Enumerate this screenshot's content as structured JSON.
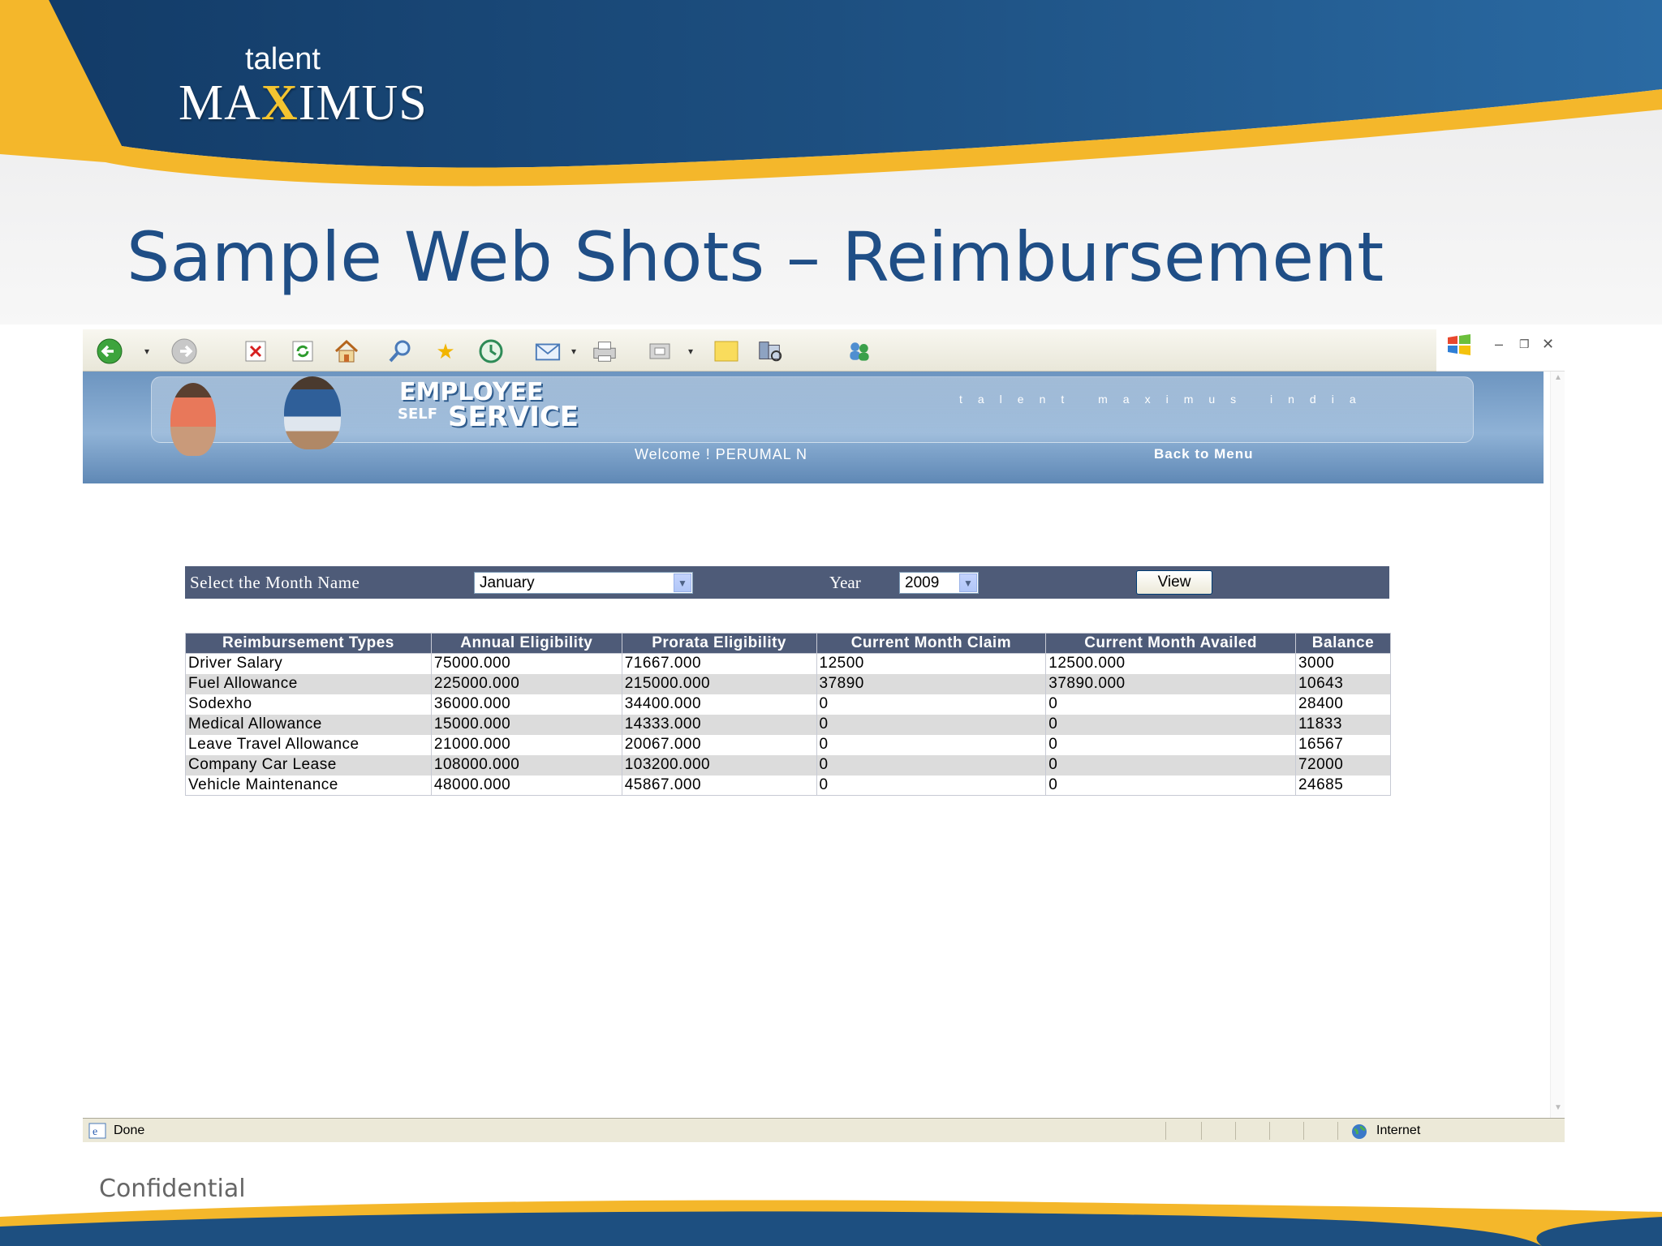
{
  "slide": {
    "logo_small": "talent",
    "logo_big_left": "MA",
    "logo_big_x": "X",
    "logo_big_right": "IMUS",
    "title": "Sample Web Shots – Reimbursement",
    "footer": "Confidential"
  },
  "toolbar": {
    "icons": [
      "back-icon",
      "forward-icon",
      "stop-icon",
      "refresh-icon",
      "home-icon",
      "search-icon",
      "favorites-icon",
      "history-icon",
      "mail-icon",
      "print-icon",
      "edit-icon",
      "notes-icon",
      "research-icon",
      "messenger-icon"
    ]
  },
  "ess": {
    "logo_line1": "EMPLOYEE",
    "logo_self": "SELF",
    "logo_service": "SERVICE",
    "tagline": "talent   maximus   india",
    "welcome": "Welcome ! PERUMAL N",
    "back_to_menu": "Back to Menu"
  },
  "filter": {
    "month_label": "Select the Month Name",
    "month_value": "January",
    "year_label": "Year",
    "year_value": "2009",
    "view_label": "View"
  },
  "table": {
    "headers": [
      "Reimbursement Types",
      "Annual Eligibility",
      "Prorata Eligibility",
      "Current Month Claim",
      "Current Month Availed",
      "Balance"
    ],
    "rows": [
      [
        "Driver Salary",
        "75000.000",
        "71667.000",
        "12500",
        "12500.000",
        "3000"
      ],
      [
        "Fuel Allowance",
        "225000.000",
        "215000.000",
        "37890",
        "37890.000",
        "10643"
      ],
      [
        "Sodexho",
        "36000.000",
        "34400.000",
        "0",
        "0",
        "28400"
      ],
      [
        "Medical Allowance",
        "15000.000",
        "14333.000",
        "0",
        "0",
        "11833"
      ],
      [
        "Leave Travel Allowance",
        "21000.000",
        "20067.000",
        "0",
        "0",
        "16567"
      ],
      [
        "Company Car Lease",
        "108000.000",
        "103200.000",
        "0",
        "0",
        "72000"
      ],
      [
        "Vehicle Maintenance",
        "48000.000",
        "45867.000",
        "0",
        "0",
        "24685"
      ]
    ]
  },
  "statusbar": {
    "left": "Done",
    "zone": "Internet"
  },
  "colors": {
    "title": "#1f4e86",
    "header_band": "#1d4f80",
    "accent_gold": "#f4b72b",
    "table_header": "#4e5b78",
    "row_alt": "#dcdcdc"
  }
}
